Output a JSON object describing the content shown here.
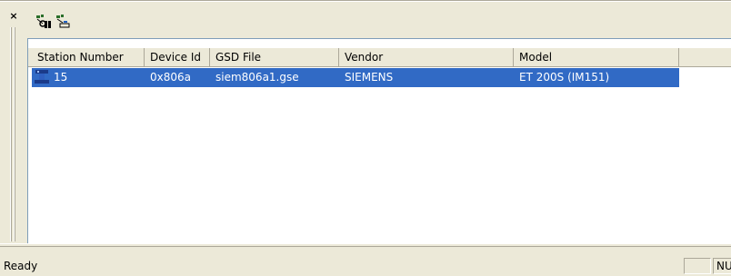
{
  "pane": {
    "close_glyph": "×"
  },
  "toolbar": {
    "buttons": [
      {
        "icon": "scan-network-icon"
      },
      {
        "icon": "identify-device-icon"
      }
    ]
  },
  "list": {
    "columns": [
      "Station Number",
      "Device Id",
      "GSD File",
      "Vendor",
      "Model"
    ],
    "rows": [
      {
        "icon": "station-device-icon",
        "station_number": "15",
        "device_id": "0x806a",
        "gsd_file": "siem806a1.gse",
        "vendor": "SIEMENS",
        "model": "ET 200S (IM151)",
        "selected": true
      }
    ]
  },
  "statusbar": {
    "text": "Ready",
    "panes": [
      "",
      "NU"
    ]
  },
  "colors": {
    "selection": "#316ac5",
    "face": "#ece9d8"
  }
}
